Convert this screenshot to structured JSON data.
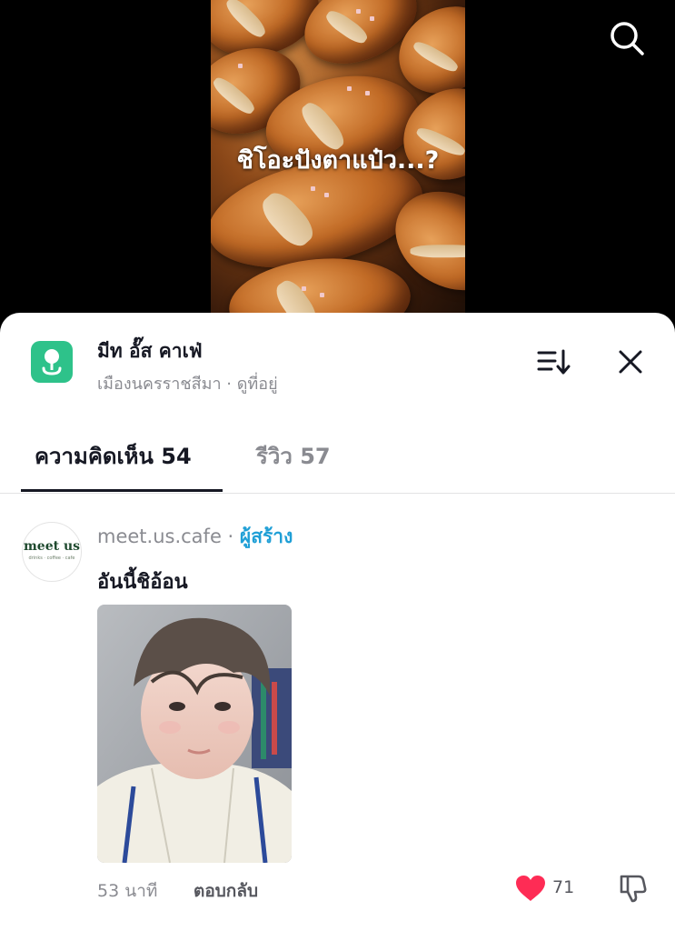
{
  "video": {
    "caption": "ชิโอะปังตาแป๋ว...?"
  },
  "header": {
    "place_name": "มีท อั๊ส คาเฟ่",
    "place_sub": "เมืองนครราชสีมา · ดูที่อยู่"
  },
  "tabs": [
    {
      "label": "ความคิดเห็น 54",
      "active": true
    },
    {
      "label": "รีวิว 57",
      "active": false
    }
  ],
  "comment": {
    "avatar_text": "meet us",
    "avatar_subtext": "drinks · coffee · cafe",
    "username": "meet.us.cafe",
    "separator": " · ",
    "creator_label": "ผู้สร้าง",
    "text": "อันนี้ชิอ้อน",
    "time": "53 นาที",
    "reply_label": "ตอบกลับ",
    "like_count": "71",
    "like_color": "#fe2c55"
  },
  "colors": {
    "accent": "#fe2c55",
    "place_icon": "#2ec28a",
    "creator": "#1f9fd6"
  },
  "icons": [
    "search-icon",
    "place-pin-icon",
    "sort-icon",
    "close-icon",
    "heart-icon",
    "dislike-icon"
  ]
}
